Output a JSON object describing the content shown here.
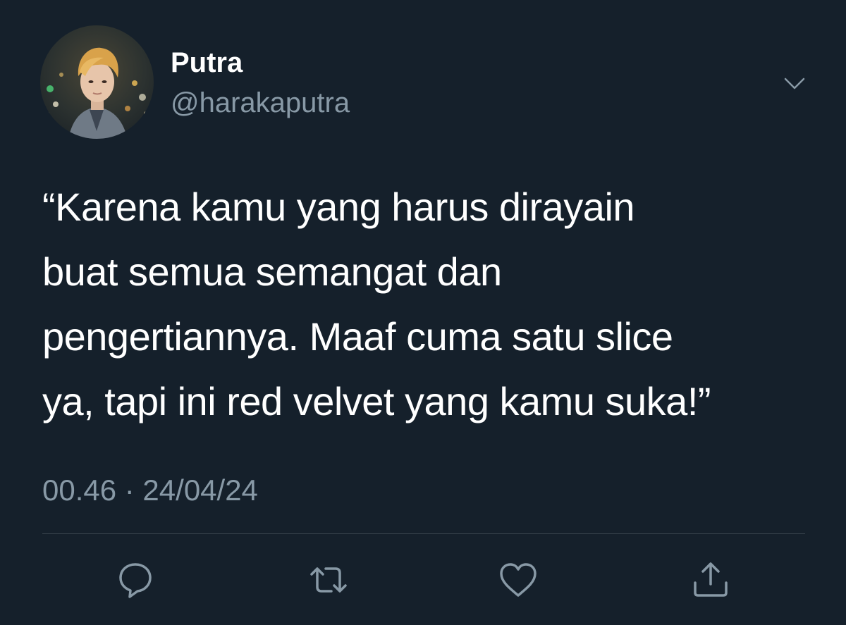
{
  "tweet": {
    "display_name": "Putra",
    "handle": "@harakaputra",
    "text": "“Karena kamu yang harus dirayain\nbuat semua semangat dan\npengertiannya. Maaf cuma satu slice\nya, tapi ini red velvet yang kamu suka!”",
    "timestamp": "00.46 · 24/04/24"
  },
  "icons": {
    "more": "chevron-down-icon",
    "reply": "reply-icon",
    "retweet": "retweet-icon",
    "like": "heart-icon",
    "share": "share-icon"
  },
  "colors": {
    "background": "#15202b",
    "primary_text": "#ffffff",
    "secondary_text": "#8899a6",
    "divider": "#38444d"
  }
}
